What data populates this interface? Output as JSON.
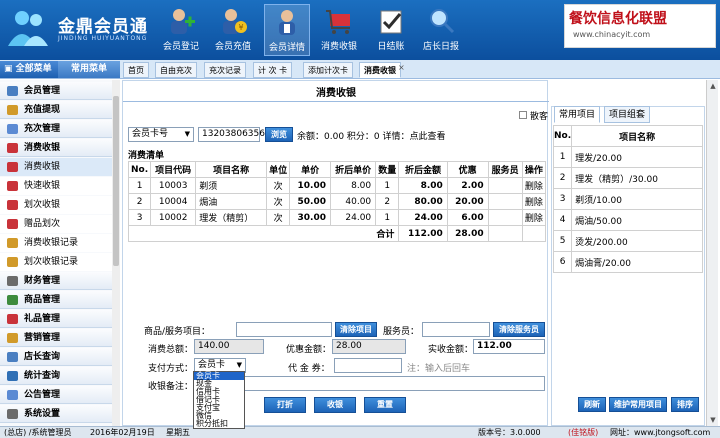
{
  "header": {
    "title": "金鼎会员通",
    "subtitle": "JINDING HUIYUANTONG",
    "toolbar": [
      {
        "label": "会员登记",
        "icon": "user-add-icon"
      },
      {
        "label": "会员充值",
        "icon": "user-recharge-icon"
      },
      {
        "label": "会员详情",
        "icon": "user-detail-icon"
      },
      {
        "label": "消费收银",
        "icon": "shopping-cart-icon"
      },
      {
        "label": "日结账",
        "icon": "ledger-check-icon"
      },
      {
        "label": "店长日报",
        "icon": "magnifier-report-icon"
      }
    ],
    "brand": {
      "title": "餐饮信息化联盟",
      "url": "www.chinacyit.com"
    }
  },
  "menu_tabs": {
    "all": "全部菜单",
    "common": "常用菜单"
  },
  "page_tabs": [
    "首页",
    "自由充次",
    "充次记录",
    "计 次 卡",
    "添加计次卡",
    "消费收银"
  ],
  "sidebar": [
    {
      "label": "会员管理",
      "type": "group",
      "color": "#4a7fc1"
    },
    {
      "label": "充值提现",
      "type": "group",
      "color": "#d19a2a"
    },
    {
      "label": "充次管理",
      "type": "group",
      "color": "#5b8ad3"
    },
    {
      "label": "消费收银",
      "type": "group",
      "color": "#c9333a"
    },
    {
      "label": "消费收银",
      "type": "sub",
      "color": "#c9333a"
    },
    {
      "label": "快速收银",
      "type": "sub",
      "color": "#c9333a"
    },
    {
      "label": "划次收银",
      "type": "sub",
      "color": "#c9333a"
    },
    {
      "label": "赠品划次",
      "type": "sub",
      "color": "#c9333a"
    },
    {
      "label": "消费收银记录",
      "type": "sub",
      "color": "#d19a2a"
    },
    {
      "label": "划次收银记录",
      "type": "sub",
      "color": "#d19a2a"
    },
    {
      "label": "财务管理",
      "type": "group",
      "color": "#6b6b6b"
    },
    {
      "label": "商品管理",
      "type": "group",
      "color": "#3d8b3d"
    },
    {
      "label": "礼品管理",
      "type": "group",
      "color": "#c9333a"
    },
    {
      "label": "营销管理",
      "type": "group",
      "color": "#d19a2a"
    },
    {
      "label": "店长查询",
      "type": "group",
      "color": "#4a7fc1"
    },
    {
      "label": "统计查询",
      "type": "group",
      "color": "#2f6fb5"
    },
    {
      "label": "公告管理",
      "type": "group",
      "color": "#5b8ad3"
    },
    {
      "label": "系统设置",
      "type": "group",
      "color": "#6b6b6b"
    }
  ],
  "main": {
    "title": "消费收银",
    "guest_label": "散客",
    "card_type": "会员卡号",
    "card_number": "13203806356",
    "browse_btn": "浏览",
    "summary": "余额：0.00 积分：0 详情：点此查看",
    "cart_title": "消费清单",
    "cart_headers": [
      "No.",
      "项目代码",
      "项目名称",
      "单位",
      "单价",
      "折后单价",
      "数量",
      "折后金额",
      "优惠",
      "服务员",
      "操作"
    ],
    "cart_rows": [
      [
        "1",
        "10003",
        "剃须",
        "次",
        "10.00",
        "8.00",
        "1",
        "8.00",
        "2.00",
        "",
        "删除"
      ],
      [
        "2",
        "10004",
        "焗油",
        "次",
        "50.00",
        "40.00",
        "2",
        "80.00",
        "20.00",
        "",
        "删除"
      ],
      [
        "3",
        "10002",
        "理发（精剪）",
        "次",
        "30.00",
        "24.00",
        "1",
        "24.00",
        "6.00",
        "",
        "删除"
      ]
    ],
    "total_label": "合计",
    "total_amount": "112.00",
    "total_discount": "28.00",
    "product_label": "商品/服务项目：",
    "clear_items_btn": "清除项目",
    "waiter_label": "服务员：",
    "clear_waiter_btn": "清除服务员",
    "total_consume_label": "消费总额：",
    "total_consume": "140.00",
    "discount_label": "优惠金额：",
    "discount": "28.00",
    "actual_label": "实收金额：",
    "actual": "112.00",
    "pay_label": "支付方式：",
    "pay_selected": "会员卡",
    "pay_options": [
      "会员卡",
      "现金",
      "信用卡",
      "借记卡",
      "支付宝",
      "微信",
      "积分抵扣"
    ],
    "voucher_label": "代 金 券：",
    "voucher_note": "注：输入后回车",
    "remark_label": "收银备注：",
    "print_btn": "打折",
    "checkout_btn": "收银",
    "reset_btn": "重置"
  },
  "right": {
    "tabs": [
      "常用项目",
      "项目组套"
    ],
    "headers": [
      "No.",
      "项目名称"
    ],
    "items": [
      [
        "1",
        "理发/20.00"
      ],
      [
        "2",
        "理发（精剪）/30.00"
      ],
      [
        "3",
        "剃须/10.00"
      ],
      [
        "4",
        "焗油/50.00"
      ],
      [
        "5",
        "烫发/200.00"
      ],
      [
        "6",
        "焗油膏/20.00"
      ]
    ],
    "refresh_btn": "刷新",
    "maintain_btn": "维护常用项目",
    "sort_btn": "排序"
  },
  "status": {
    "user": "(总店) /系统管理员",
    "date": "2016年02月19日",
    "weekday": "星期五",
    "version_label": "版本号：3.0.000",
    "edition": "(佳铭版)",
    "website": "网址：www.jtongsoft.com"
  }
}
